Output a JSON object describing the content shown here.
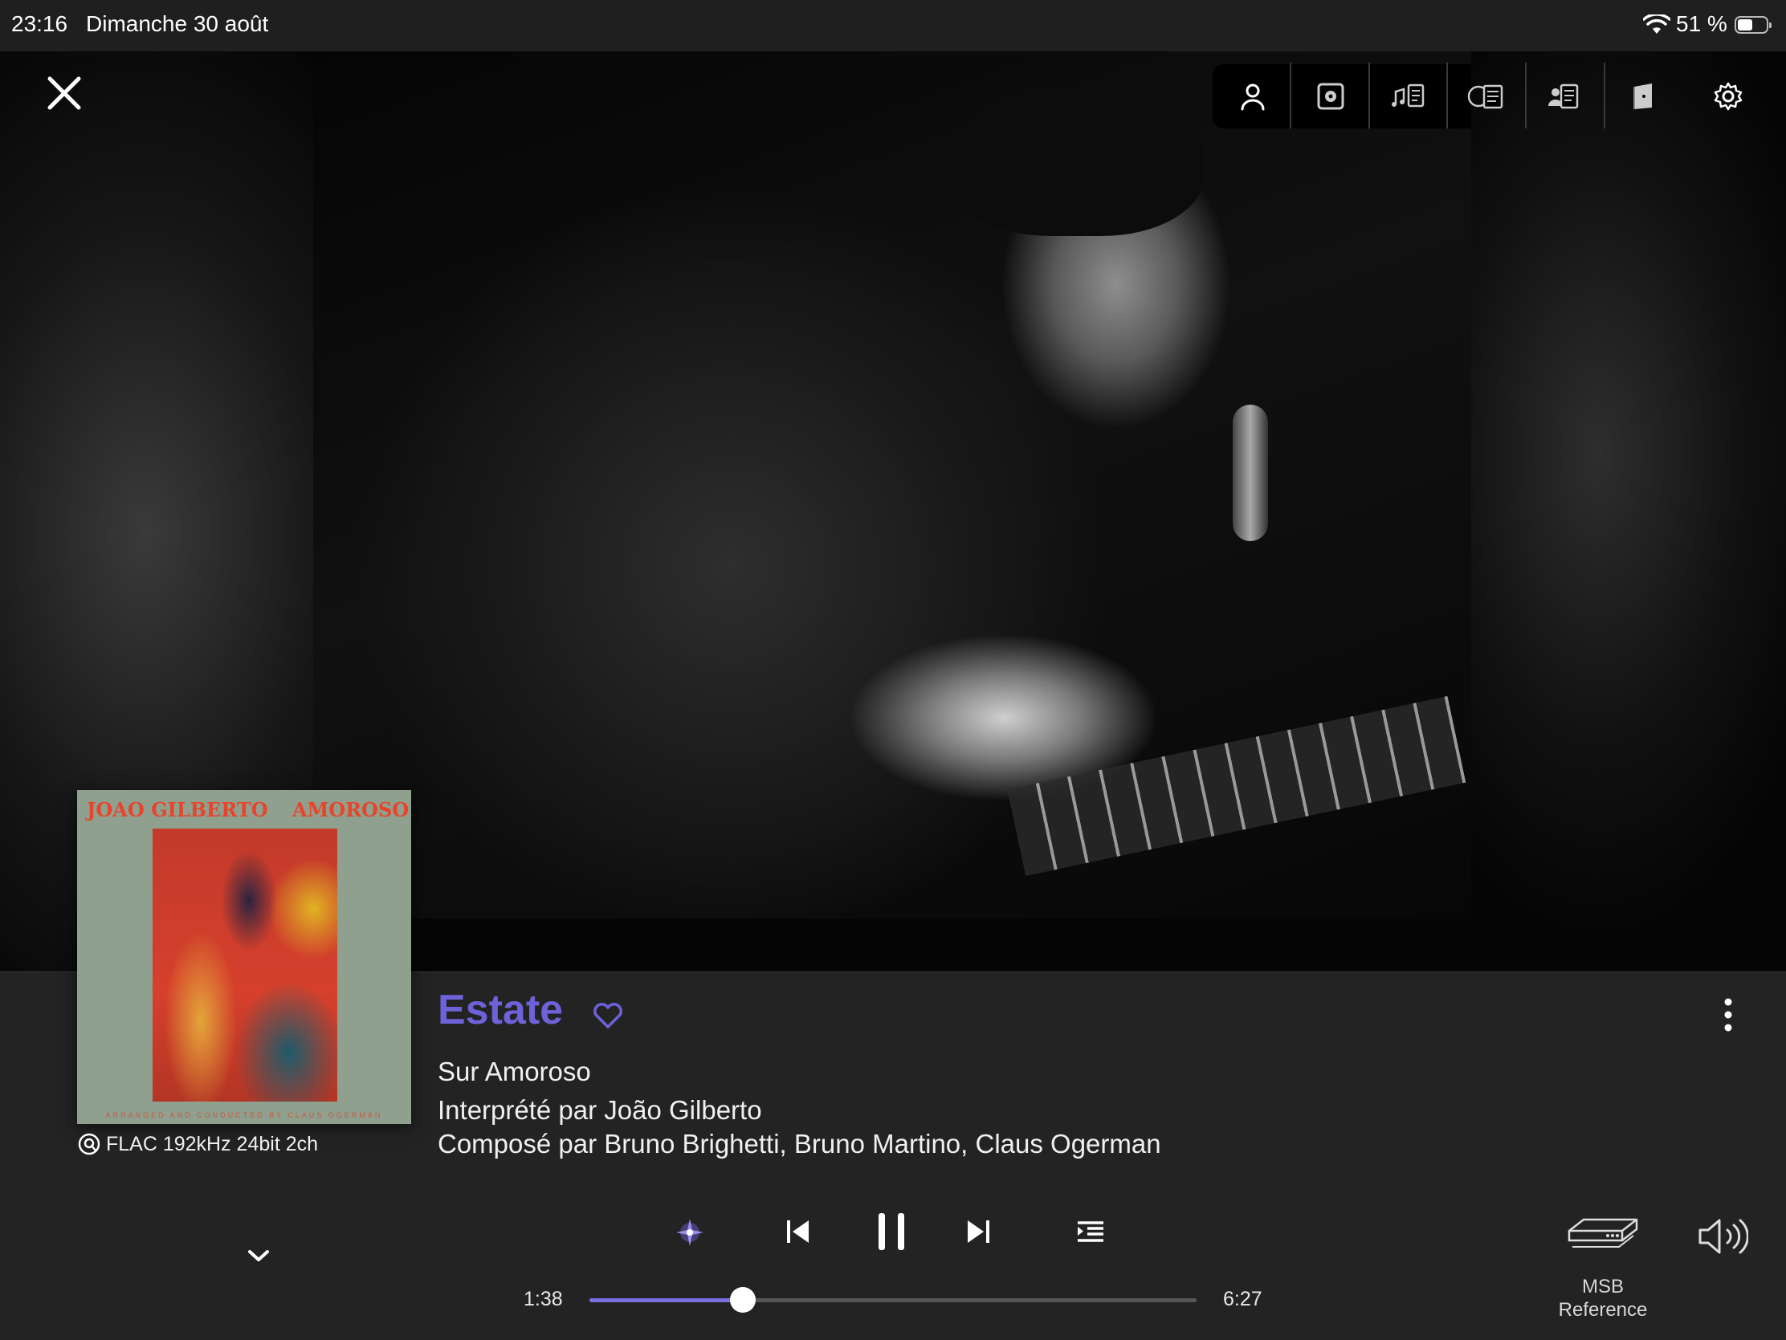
{
  "status_bar": {
    "time": "23:16",
    "date": "Dimanche 30 août",
    "battery": "51 %"
  },
  "toolbar": {
    "icons": [
      "close-icon",
      "artist-icon",
      "album-icon",
      "lyrics-icon",
      "credits-icon",
      "biography-icon",
      "booklet-icon",
      "settings-icon"
    ]
  },
  "album_cover": {
    "artist_text": "JOAO GILBERTO",
    "album_text": "AMOROSO",
    "credit_text": "ARRANGED AND CONDUCTED BY CLAUS OGERMAN"
  },
  "track": {
    "title": "Estate",
    "album_line": "Sur Amoroso",
    "performer_line": "Interprété par João Gilberto",
    "composer_line": "Composé par Bruno Brighetti, Bruno Martino, Claus Ogerman",
    "format": "FLAC 192kHz 24bit 2ch",
    "favorite": false
  },
  "playback": {
    "elapsed": "1:38",
    "duration": "6:27",
    "progress_fraction": 0.253,
    "state": "playing"
  },
  "output_device": {
    "name_line1": "MSB",
    "name_line2": "Reference"
  },
  "colors": {
    "accent": "#6e62d9",
    "panel_bg": "#232323",
    "status_bg": "#1f1f1f"
  }
}
